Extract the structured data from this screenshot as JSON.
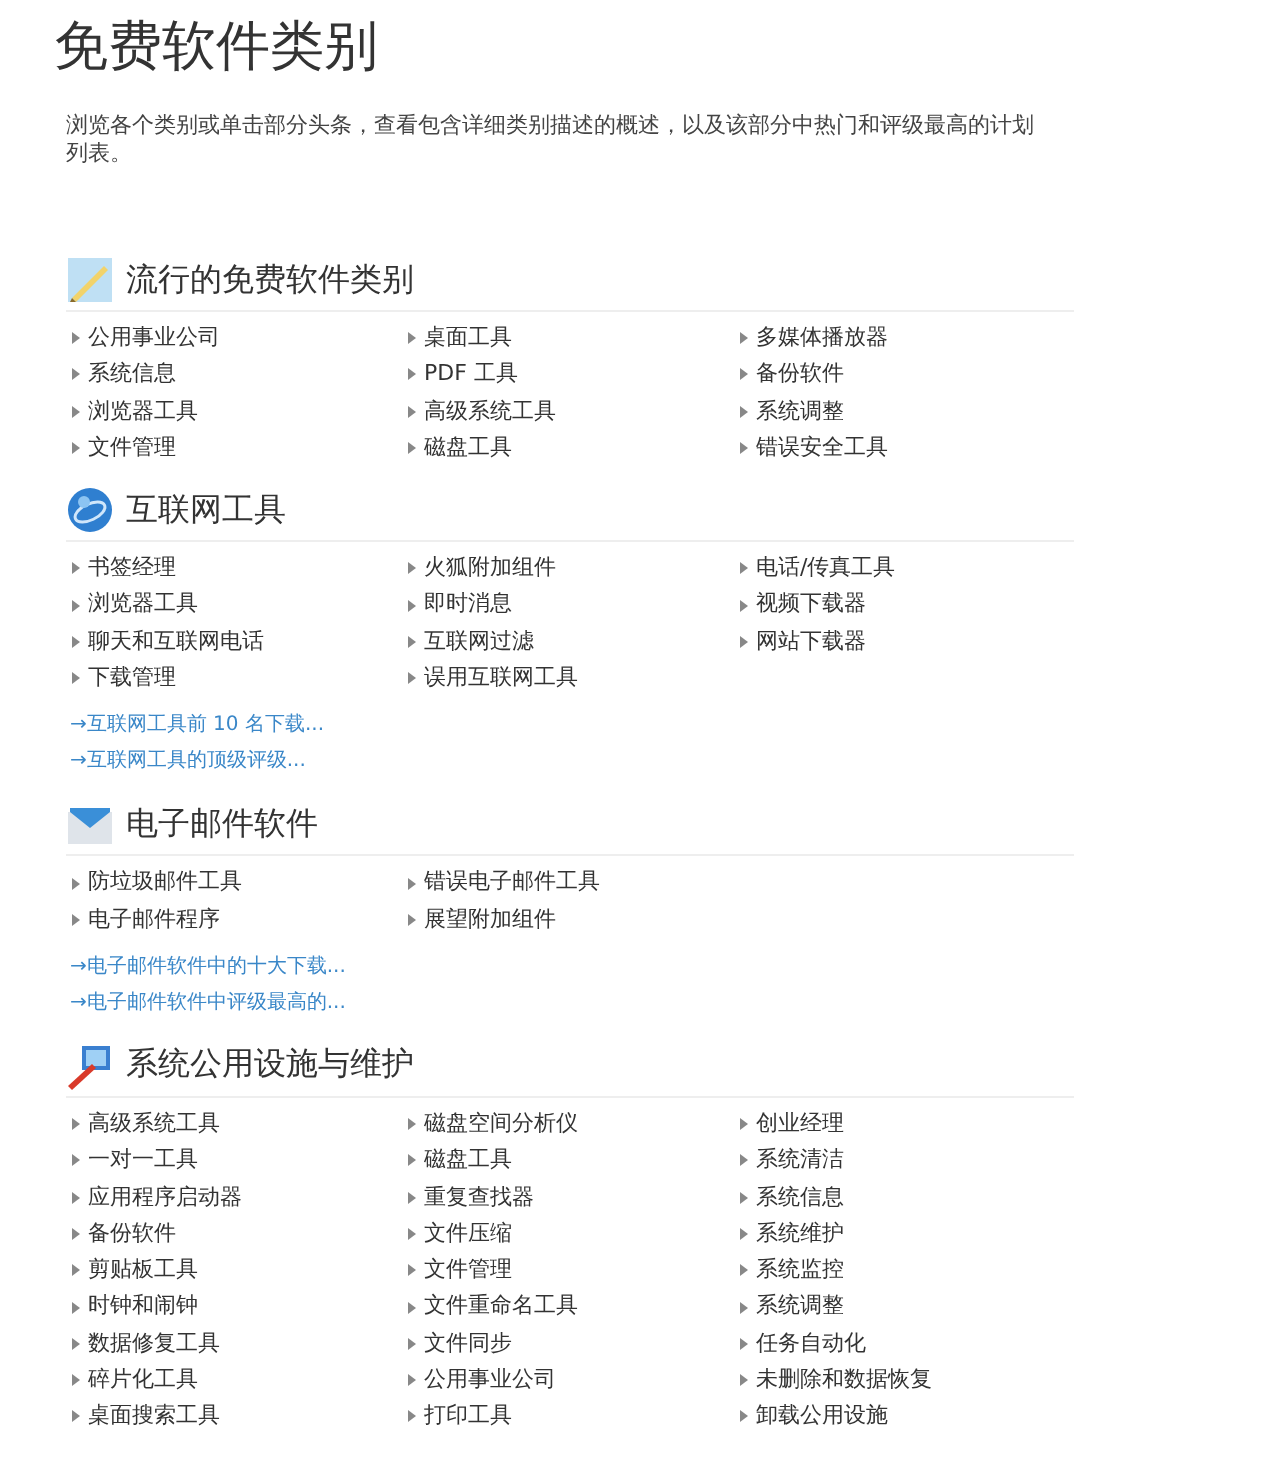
{
  "title": "免费软件类别",
  "description": "浏览各个类别或单击部分头条，查看包含详细类别描述的概述，以及该部分中热门和评级最高的计划列表。",
  "sections": [
    {
      "heading": "流行的免费软件类别",
      "columns": [
        [
          "公用事业公司",
          "系统信息",
          "浏览器工具",
          "文件管理"
        ],
        [
          "桌面工具",
          "PDF 工具",
          "高级系统工具",
          "磁盘工具"
        ],
        [
          "多媒体播放器",
          "备份软件",
          "系统调整",
          "错误安全工具"
        ]
      ]
    },
    {
      "heading": "互联网工具",
      "columns": [
        [
          "书签经理",
          "浏览器工具",
          "聊天和互联网电话",
          "下载管理"
        ],
        [
          "火狐附加组件",
          "即时消息",
          "互联网过滤",
          "误用互联网工具"
        ],
        [
          "电话/传真工具",
          "视频下载器",
          "网站下载器"
        ]
      ],
      "links": [
        "→互联网工具前 10 名下载...",
        "→互联网工具的顶级评级..."
      ]
    },
    {
      "heading": "电子邮件软件",
      "columns": [
        [
          "防垃圾邮件工具",
          "电子邮件程序"
        ],
        [
          "错误电子邮件工具",
          "展望附加组件"
        ]
      ],
      "links": [
        "→电子邮件软件中的十大下载...",
        "→电子邮件软件中评级最高的..."
      ]
    },
    {
      "heading": "系统公用设施与维护",
      "columns": [
        [
          "高级系统工具",
          "一对一工具",
          "应用程序启动器",
          "备份软件",
          "剪贴板工具",
          "时钟和闹钟",
          "数据修复工具",
          "碎片化工具",
          "桌面搜索工具"
        ],
        [
          "磁盘空间分析仪",
          "磁盘工具",
          "重复查找器",
          "文件压缩",
          "文件管理",
          "文件重命名工具",
          "文件同步",
          "公用事业公司",
          "打印工具"
        ],
        [
          "创业经理",
          "系统清洁",
          "系统信息",
          "系统维护",
          "系统监控",
          "系统调整",
          "任务自动化",
          "未删除和数据恢复",
          "卸载公用设施"
        ]
      ]
    }
  ]
}
